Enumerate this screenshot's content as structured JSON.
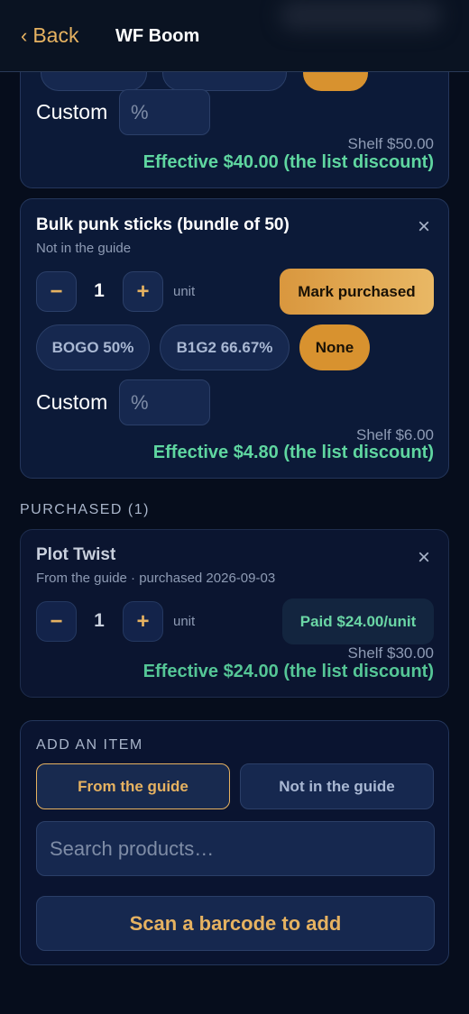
{
  "header": {
    "back_label": "Back",
    "title": "WF Boom"
  },
  "card_top": {
    "custom_label": "Custom",
    "custom_placeholder": "%",
    "shelf": "Shelf $50.00",
    "effective": "Effective $40.00 (the list discount)"
  },
  "card_bulk": {
    "name": "Bulk punk sticks (bundle of 50)",
    "subtitle": "Not in the guide",
    "quantity": "1",
    "unit": "unit",
    "mark_label": "Mark purchased",
    "discounts": [
      "BOGO 50%",
      "B1G2 66.67%",
      "None"
    ],
    "selected_discount": "None",
    "custom_label": "Custom",
    "custom_placeholder": "%",
    "shelf": "Shelf $6.00",
    "effective": "Effective $4.80 (the list discount)"
  },
  "purchased_section": {
    "label": "PURCHASED (1)"
  },
  "card_plot": {
    "name": "Plot Twist",
    "subtitle": "From the guide · purchased 2026-09-03",
    "quantity": "1",
    "unit": "unit",
    "paid_label": "Paid $24.00/unit",
    "shelf": "Shelf $30.00",
    "effective": "Effective $24.00 (the list discount)"
  },
  "add_item": {
    "label": "ADD AN ITEM",
    "tab_from_guide": "From the guide",
    "tab_not_in_guide": "Not in the guide",
    "search_placeholder": "Search products…",
    "scan_label": "Scan a barcode to add"
  },
  "icons": {
    "back": "chevron-left-icon",
    "close": "close-icon",
    "minus": "minus-icon",
    "plus": "plus-icon"
  },
  "colors": {
    "accent": "#e6b261",
    "effective_green": "#5fd6a0",
    "background": "#060d1c",
    "card": "#0c1a38"
  }
}
